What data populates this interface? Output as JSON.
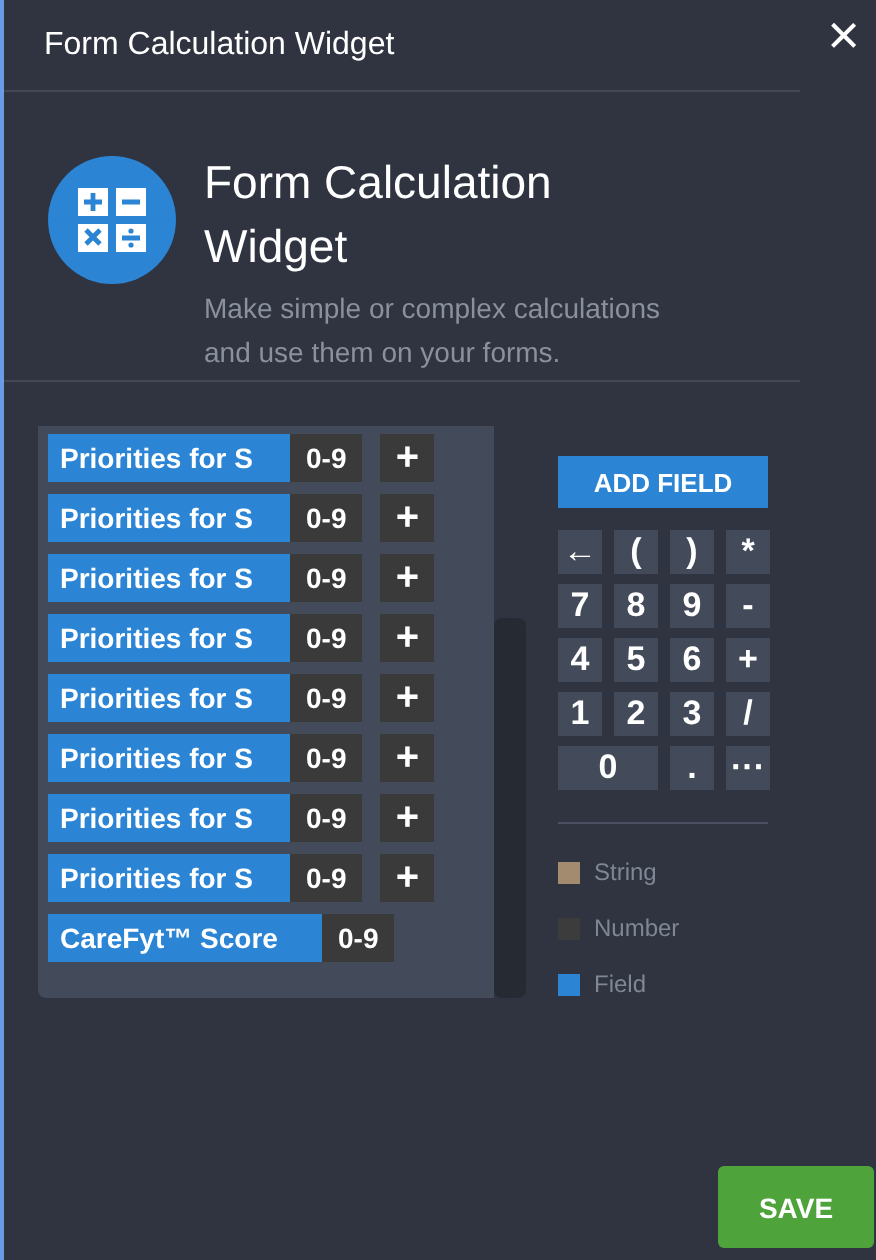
{
  "window": {
    "title": "Form Calculation Widget",
    "close": "×"
  },
  "widget": {
    "name": "Form Calculation Widget",
    "description": "Make simple or complex calculations and use them on your forms."
  },
  "formula": {
    "rows": [
      {
        "field": "Priorities for S",
        "number": "0-9",
        "plus": "+"
      },
      {
        "field": "Priorities for S",
        "number": "0-9",
        "plus": "+"
      },
      {
        "field": "Priorities for S",
        "number": "0-9",
        "plus": "+"
      },
      {
        "field": "Priorities for S",
        "number": "0-9",
        "plus": "+"
      },
      {
        "field": "Priorities for S",
        "number": "0-9",
        "plus": "+"
      },
      {
        "field": "Priorities for S",
        "number": "0-9",
        "plus": "+"
      },
      {
        "field": "Priorities for S",
        "number": "0-9",
        "plus": "+"
      },
      {
        "field": "Priorities for S",
        "number": "0-9",
        "plus": "+"
      },
      {
        "field": "CareFyt™ Score",
        "number": "0-9"
      }
    ]
  },
  "add_field": "ADD FIELD",
  "keypad": [
    {
      "label": "←",
      "kind": "normal"
    },
    {
      "label": "(",
      "kind": "normal"
    },
    {
      "label": ")",
      "kind": "normal"
    },
    {
      "label": "*",
      "kind": "normal"
    },
    {
      "label": "7",
      "kind": "normal"
    },
    {
      "label": "8",
      "kind": "normal"
    },
    {
      "label": "9",
      "kind": "normal"
    },
    {
      "label": "-",
      "kind": "normal"
    },
    {
      "label": "4",
      "kind": "normal"
    },
    {
      "label": "5",
      "kind": "normal"
    },
    {
      "label": "6",
      "kind": "normal"
    },
    {
      "label": "+",
      "kind": "normal"
    },
    {
      "label": "1",
      "kind": "normal"
    },
    {
      "label": "2",
      "kind": "normal"
    },
    {
      "label": "3",
      "kind": "normal"
    },
    {
      "label": "/",
      "kind": "normal"
    },
    {
      "label": "0",
      "kind": "wide"
    },
    {
      "label": ".",
      "kind": "normal"
    },
    {
      "label": "···",
      "kind": "normal"
    }
  ],
  "legend": [
    {
      "label": "String",
      "color": "#a38b6f"
    },
    {
      "label": "Number",
      "color": "#3c3c3c"
    },
    {
      "label": "Field",
      "color": "#2b84d4"
    }
  ],
  "save": "SAVE"
}
